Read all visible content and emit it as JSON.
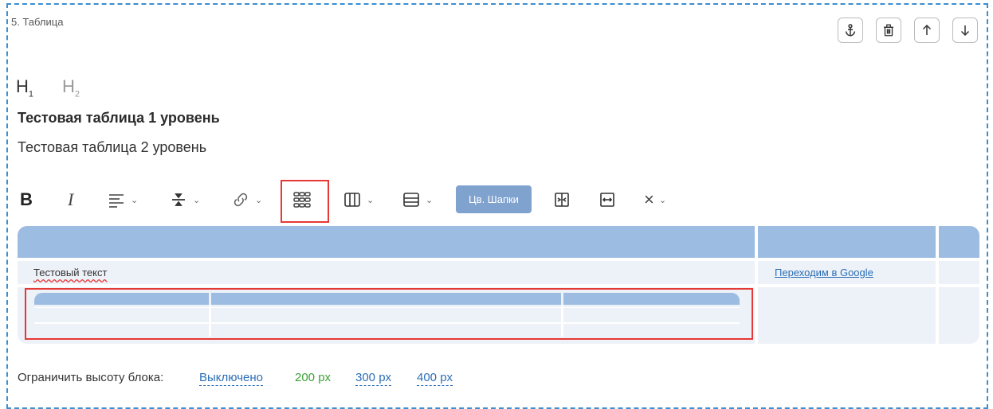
{
  "block": {
    "title": "5. Таблица"
  },
  "controls": [
    {
      "name": "anchor-button",
      "icon": "anchor-icon"
    },
    {
      "name": "delete-button",
      "icon": "trash-icon"
    },
    {
      "name": "move-up-button",
      "icon": "arrow-up-icon"
    },
    {
      "name": "move-down-button",
      "icon": "arrow-down-icon"
    }
  ],
  "headings": {
    "h1": "H",
    "h1_sub": "1",
    "h2": "H",
    "h2_sub": "2"
  },
  "titles": {
    "level1": "Тестовая таблица 1 уровень",
    "level2": "Тестовая таблица 2 уровень"
  },
  "toolbar": {
    "bold": "B",
    "italic": "I",
    "chevron": "⌄",
    "header_color_label": "Цв. Шапки",
    "clear": "×"
  },
  "table": {
    "header_color": "#9dbce2",
    "row_color": "#edf1f8",
    "cell_text": "Тестовый текст",
    "link_text": "Переходим в Google"
  },
  "footer": {
    "label": "Ограничить высоту блока:",
    "options": [
      "Выключено",
      "200 px",
      "300 px",
      "400 px"
    ]
  },
  "colors": {
    "accent": "#3b8fd1",
    "highlight": "#e53935",
    "active_option": "#3aa135",
    "link": "#2b6fb5"
  }
}
